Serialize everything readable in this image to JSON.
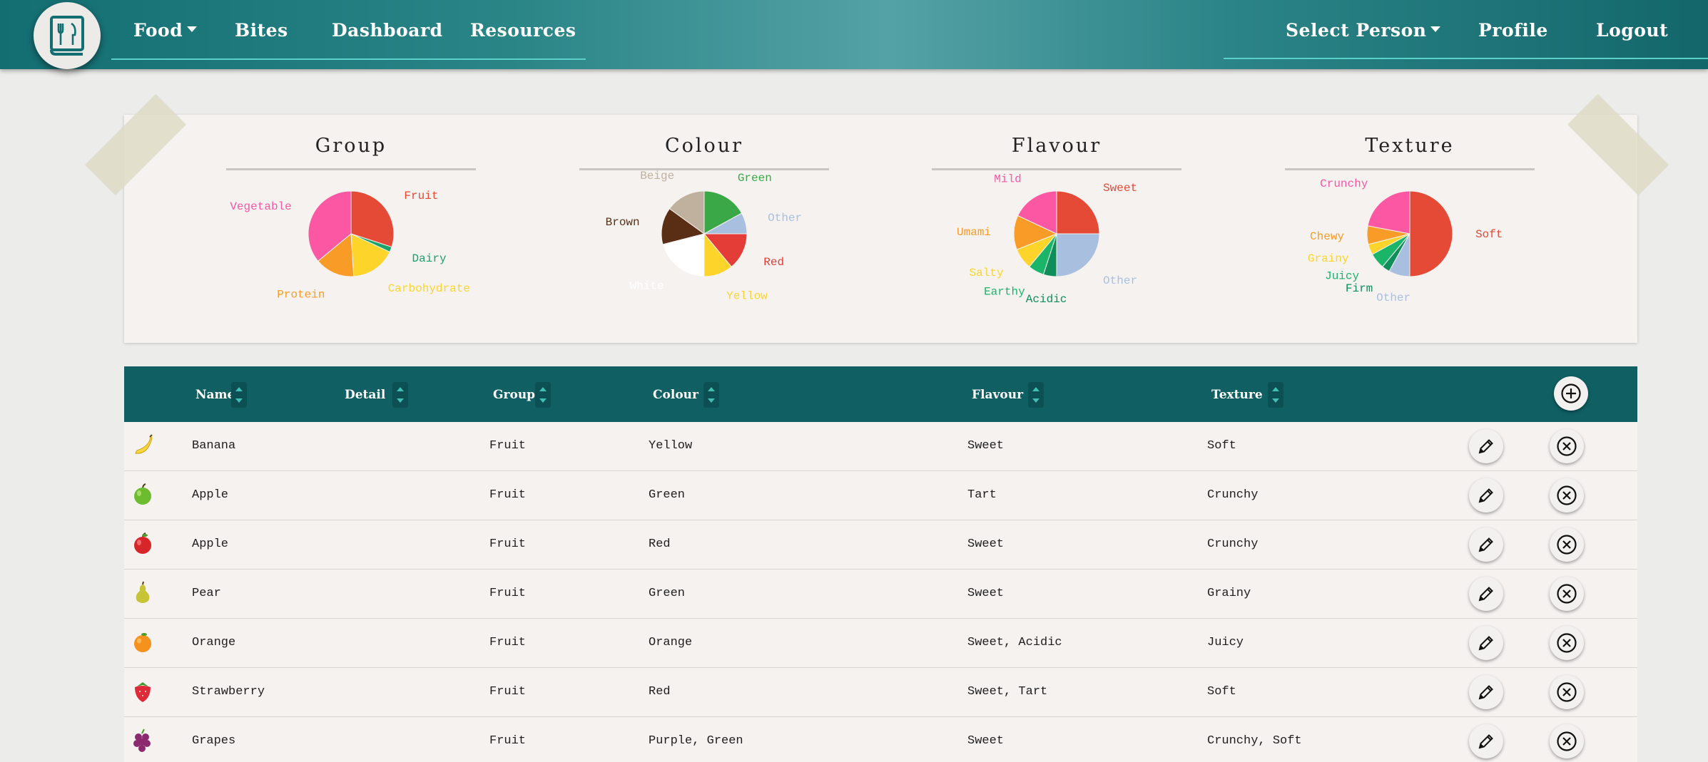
{
  "nav": {
    "left": [
      {
        "label": "Food",
        "dropdown": true
      },
      {
        "label": "Bites",
        "dropdown": false
      },
      {
        "label": "Dashboard",
        "dropdown": false
      },
      {
        "label": "Resources",
        "dropdown": false
      }
    ],
    "right": [
      {
        "label": "Select Person",
        "dropdown": true
      },
      {
        "label": "Profile",
        "dropdown": false
      },
      {
        "label": "Logout",
        "dropdown": false
      }
    ],
    "logo_icon": "fork-knife-book-icon"
  },
  "charts": [
    {
      "title": "Group",
      "slices": [
        {
          "label": "Fruit",
          "value": 30,
          "color": "#e44a36"
        },
        {
          "label": "Dairy",
          "value": 2,
          "color": "#1aa36a"
        },
        {
          "label": "Carbohydrate",
          "value": 17,
          "color": "#fdd52a"
        },
        {
          "label": "Protein",
          "value": 15,
          "color": "#f89c27"
        },
        {
          "label": "Vegetable",
          "value": 36,
          "color": "#fb57a2"
        }
      ]
    },
    {
      "title": "Colour",
      "slices": [
        {
          "label": "Green",
          "value": 17,
          "color": "#3aa846"
        },
        {
          "label": "Other",
          "value": 8,
          "color": "#a9bfe0"
        },
        {
          "label": "Red",
          "value": 14,
          "color": "#e43c36"
        },
        {
          "label": "Yellow",
          "value": 11,
          "color": "#fdd52a"
        },
        {
          "label": "White",
          "value": 21,
          "color": "#ffffff"
        },
        {
          "label": "Brown",
          "value": 14,
          "color": "#5a2e14"
        },
        {
          "label": "Beige",
          "value": 15,
          "color": "#bfb19d"
        }
      ]
    },
    {
      "title": "Flavour",
      "slices": [
        {
          "label": "Sweet",
          "value": 25,
          "color": "#e44a36"
        },
        {
          "label": "Other",
          "value": 25,
          "color": "#a9bfe0"
        },
        {
          "label": "Acidic",
          "value": 5,
          "color": "#0e8f5a"
        },
        {
          "label": "Earthy",
          "value": 6,
          "color": "#1bb56a"
        },
        {
          "label": "Salty",
          "value": 8,
          "color": "#fdd52a"
        },
        {
          "label": "Umami",
          "value": 13,
          "color": "#f89c27"
        },
        {
          "label": "Mild",
          "value": 18,
          "color": "#fb57a2"
        }
      ]
    },
    {
      "title": "Texture",
      "slices": [
        {
          "label": "Soft",
          "value": 50,
          "color": "#e44a36"
        },
        {
          "label": "Other",
          "value": 8,
          "color": "#a9bfe0"
        },
        {
          "label": "Firm",
          "value": 3,
          "color": "#0e8f5a"
        },
        {
          "label": "Juicy",
          "value": 6,
          "color": "#1bb56a"
        },
        {
          "label": "Grainy",
          "value": 4,
          "color": "#fdd52a"
        },
        {
          "label": "Chewy",
          "value": 7,
          "color": "#f89c27"
        },
        {
          "label": "Crunchy",
          "value": 22,
          "color": "#fb57a2"
        }
      ]
    }
  ],
  "table": {
    "headers": [
      "Name",
      "Detail",
      "Group",
      "Colour",
      "Flavour",
      "Texture"
    ],
    "rows": [
      {
        "icon": "banana-icon",
        "name": "Banana",
        "detail": "",
        "group": "Fruit",
        "colour": "Yellow",
        "flavour": "Sweet",
        "texture": "Soft"
      },
      {
        "icon": "green-apple-icon",
        "name": "Apple",
        "detail": "",
        "group": "Fruit",
        "colour": "Green",
        "flavour": "Tart",
        "texture": "Crunchy"
      },
      {
        "icon": "red-apple-icon",
        "name": "Apple",
        "detail": "",
        "group": "Fruit",
        "colour": "Red",
        "flavour": "Sweet",
        "texture": "Crunchy"
      },
      {
        "icon": "pear-icon",
        "name": "Pear",
        "detail": "",
        "group": "Fruit",
        "colour": "Green",
        "flavour": "Sweet",
        "texture": "Grainy"
      },
      {
        "icon": "orange-icon",
        "name": "Orange",
        "detail": "",
        "group": "Fruit",
        "colour": "Orange",
        "flavour": "Sweet, Acidic",
        "texture": "Juicy"
      },
      {
        "icon": "strawberry-icon",
        "name": "Strawberry",
        "detail": "",
        "group": "Fruit",
        "colour": "Red",
        "flavour": "Sweet, Tart",
        "texture": "Soft"
      },
      {
        "icon": "grapes-icon",
        "name": "Grapes",
        "detail": "",
        "group": "Fruit",
        "colour": "Purple, Green",
        "flavour": "Sweet",
        "texture": "Crunchy, Soft"
      }
    ]
  }
}
